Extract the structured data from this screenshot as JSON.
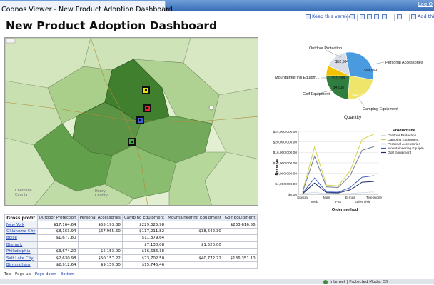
{
  "window": {
    "title": "Cognos Viewer - New Product Adoption Dashboard",
    "logout_label": "Log O"
  },
  "toolbar": {
    "keep_version_label": "Keep this version",
    "add_this_label": "Add this r"
  },
  "page": {
    "title": "New Product Adoption Dashboard"
  },
  "map": {
    "markers": [
      {
        "color": "#e8e000"
      },
      {
        "color": "#e3262b"
      },
      {
        "color": "#3b5fd6"
      },
      {
        "color": "#40b040"
      }
    ],
    "place_labels": [
      "Cherokee",
      "County",
      "Henry",
      "County"
    ]
  },
  "pie": {
    "title": "Quantity",
    "slices": [
      {
        "label": "Outdoor Protection",
        "value_label": "$52,804",
        "color": "#4a9ae0"
      },
      {
        "label": "Personal Accessories",
        "value_label": "$99,969",
        "color": "#efe56a"
      },
      {
        "label": "Camping Equipment",
        "value_label": "$66,334",
        "color": "#2f7d3f"
      },
      {
        "label": "Golf Equipment",
        "value_label": "$4,910",
        "color": "#f2c200"
      },
      {
        "label": "Mountaineering Equipm...",
        "value_label": "$31,398",
        "color": "#d8dde8"
      }
    ]
  },
  "chart_data": {
    "type": "line",
    "title": "",
    "xlabel": "Order method",
    "ylabel": "Revenue",
    "categories": [
      "Special",
      "Web",
      "Mail",
      "Fax",
      "E-mail",
      "Sales visit",
      "Telephone"
    ],
    "ylim": [
      0,
      24000000
    ],
    "yticks": [
      "$0.00",
      "$4,000,000.00",
      "$8,000,000.00",
      "$12,000,000.00",
      "$16,000,000.00",
      "$20,000,000.00",
      "$24,000,000.00"
    ],
    "legend_title": "Product line",
    "legend_position": "right",
    "series": [
      {
        "name": "Outdoor Protection",
        "color": "#d6dde9",
        "values": [
          300000,
          700000,
          200000,
          150000,
          300000,
          600000,
          900000
        ]
      },
      {
        "name": "Camping Equipment",
        "color": "#d6d04a",
        "values": [
          1200000,
          18000000,
          3500000,
          3200000,
          9000000,
          21000000,
          23000000
        ]
      },
      {
        "name": "Personal Accessories",
        "color": "#6f7f95",
        "values": [
          900000,
          14500000,
          2800000,
          2600000,
          7200000,
          16800000,
          18200000
        ]
      },
      {
        "name": "Mountaineering Equipm...",
        "color": "#3a5cc0",
        "values": [
          400000,
          6200000,
          900000,
          800000,
          2600000,
          6500000,
          7100000
        ]
      },
      {
        "name": "Golf Equipment",
        "color": "#1a2a5e",
        "values": [
          200000,
          4300000,
          600000,
          500000,
          1700000,
          4600000,
          4900000
        ]
      }
    ]
  },
  "grid": {
    "corner_label": "Gross profit",
    "columns": [
      "Outdoor Protection",
      "Personal Accessories",
      "Camping Equipment",
      "Mountaineering Equipment",
      "Golf Equipment"
    ],
    "rows": [
      {
        "label": "New York",
        "cells": [
          "$17,164.64",
          "$55,193.88",
          "$229,325.98",
          "",
          "$233,616.56"
        ]
      },
      {
        "label": "Oklahoma City",
        "cells": [
          "$8,163.94",
          "$67,965.60",
          "$117,211.82",
          "$38,642.30",
          ""
        ]
      },
      {
        "label": "Boise",
        "cells": [
          "$1,677.80",
          "",
          "$11,879.64",
          "",
          ""
        ]
      },
      {
        "label": "Bismark",
        "cells": [
          "",
          "",
          "$7,130.08",
          "$1,520.00",
          ""
        ]
      },
      {
        "label": "Philadelphia",
        "cells": [
          "$3,674.20",
          "$5,153.00",
          "$16,636.18",
          "",
          ""
        ]
      },
      {
        "label": "Salt Lake City",
        "cells": [
          "$2,630.98",
          "$50,157.22",
          "$73,702.50",
          "$40,772.72",
          "$136,351.10"
        ]
      },
      {
        "label": "Birmingham",
        "cells": [
          "$2,912.64",
          "$9,159.30",
          "$15,745.46",
          "",
          ""
        ]
      }
    ]
  },
  "pager": {
    "top": "Top",
    "page_up": "Page up",
    "page_down": "Page down",
    "bottom": "Bottom"
  },
  "status": {
    "zone_label": "Internet | Protected Mode: Off"
  }
}
